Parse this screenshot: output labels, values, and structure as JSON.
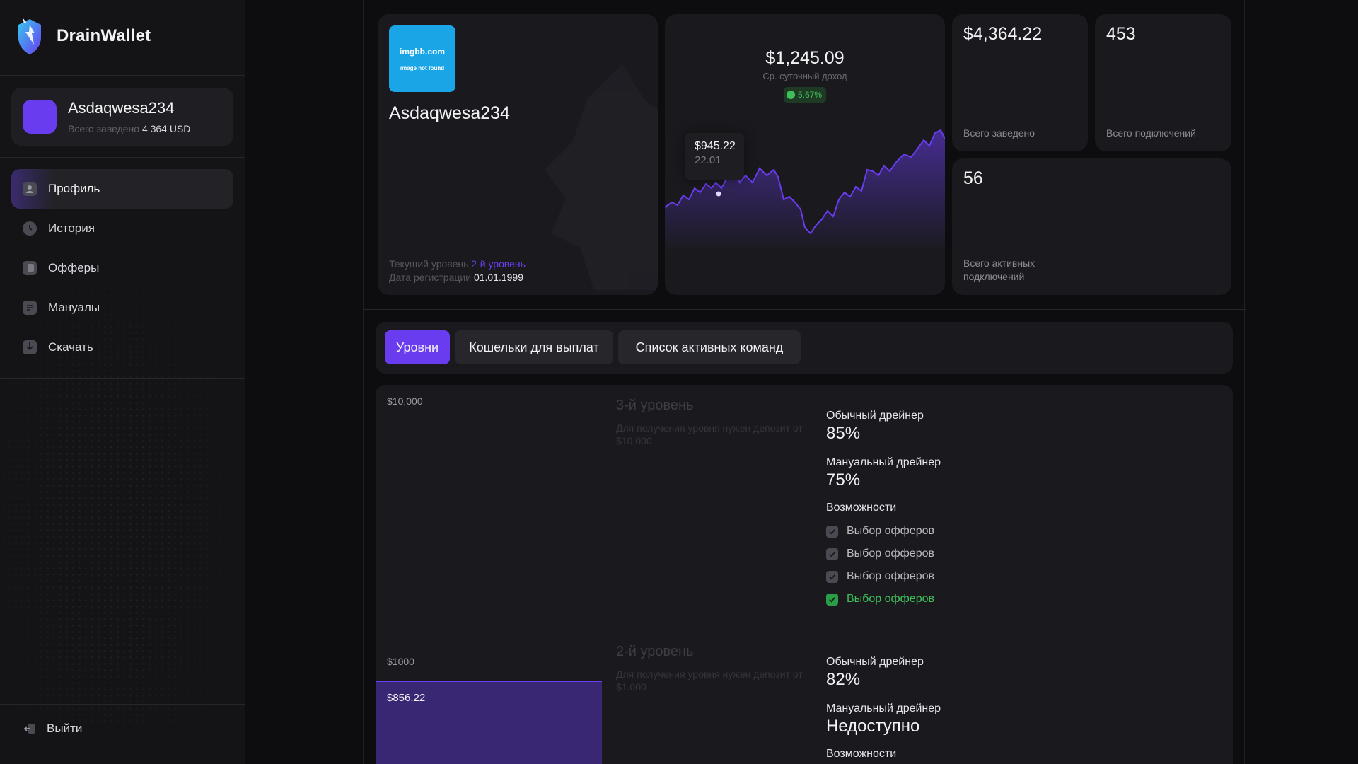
{
  "brand": {
    "name": "DrainWallet"
  },
  "user": {
    "name": "Asdaqwesa234",
    "deposit_label": "Всего заведено",
    "deposit_value": "4 364 USD"
  },
  "nav": {
    "items": [
      {
        "label": "Профиль",
        "active": true
      },
      {
        "label": "История"
      },
      {
        "label": "Офферы"
      },
      {
        "label": "Мануалы"
      },
      {
        "label": "Скачать"
      }
    ],
    "logout": "Выйти"
  },
  "profile": {
    "image_text_1": "imgbb.com",
    "image_text_2": "image not found",
    "name": "Asdaqwesa234",
    "level_label": "Текущий уровень",
    "level_value": "2-й уровень",
    "reg_label": "Дата регистрации",
    "reg_value": "01.01.1999"
  },
  "daily": {
    "value": "$1,245.09",
    "label": "Ср. суточный доход",
    "change": "5.67%",
    "tooltip_value": "$945.22",
    "tooltip_date": "22.01"
  },
  "stats": {
    "total_deposit": {
      "value": "$4,364.22",
      "label": "Всего заведено"
    },
    "total_connections": {
      "value": "453",
      "label": "Всего подключений"
    },
    "active_connections": {
      "value": "56",
      "label": "Всего активных подключений"
    }
  },
  "tabs": [
    "Уровни",
    "Кошельки для выплат",
    "Список активных команд"
  ],
  "levels": {
    "axis_top": "$10,000",
    "axis_mid": "$1000",
    "current_amount": "$856.22",
    "level3": {
      "title": "3-й уровень",
      "note": "Для получения уровня нужен депозит от $10.000",
      "regular_label": "Обычный дрейнер",
      "regular_value": "85%",
      "manual_label": "Мануальный дрейнер",
      "manual_value": "75%",
      "features_label": "Возможности",
      "features": [
        "Выбор офферов",
        "Выбор офферов",
        "Выбор офферов",
        "Выбор офферов"
      ]
    },
    "level2": {
      "title": "2-й уровень",
      "note": "Для получения уровня нужен депозит от $1.000",
      "regular_label": "Обычный дрейнер",
      "regular_value": "82%",
      "manual_label": "Мануальный дрейнер",
      "manual_value": "Недоступно",
      "features_label": "Возможности"
    }
  },
  "colors": {
    "accent": "#6a3cf0",
    "success": "#3fbf5a",
    "image_placeholder": "#19a5e6"
  }
}
